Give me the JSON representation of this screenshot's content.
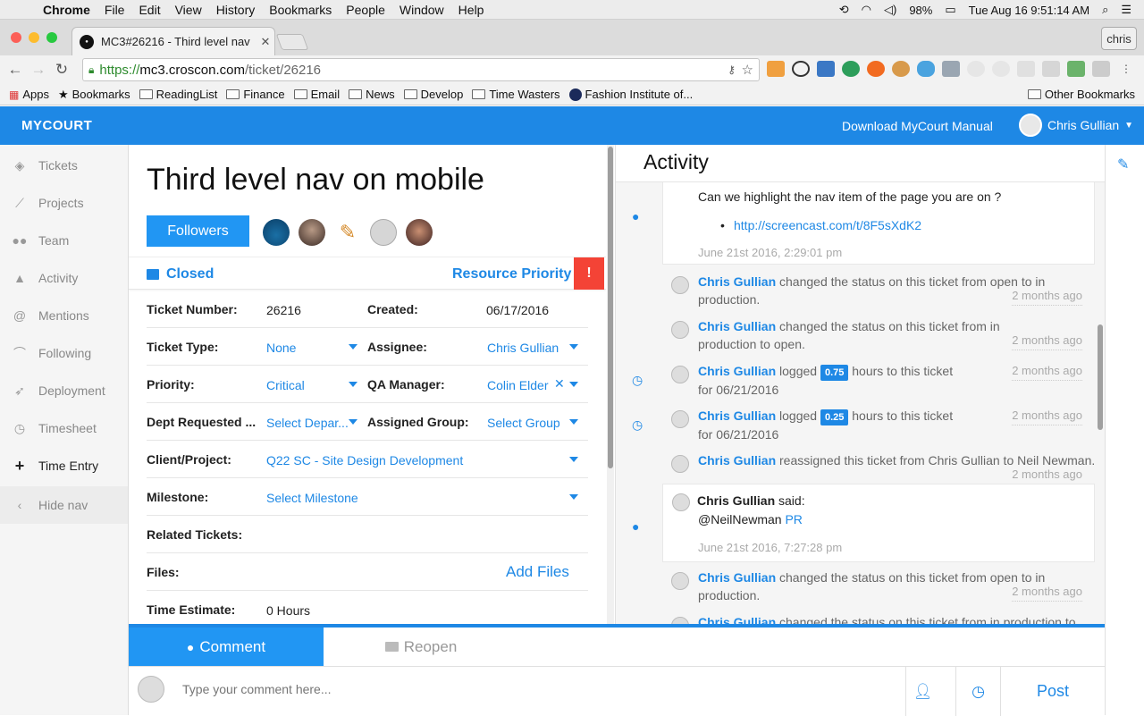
{
  "menubar": {
    "app": "Chrome",
    "items": [
      "File",
      "Edit",
      "View",
      "History",
      "Bookmarks",
      "People",
      "Window",
      "Help"
    ],
    "battery": "98%",
    "clock": "Tue Aug 16  9:51:14 AM"
  },
  "browser": {
    "tab_title": "MC3#26216 - Third level nav",
    "profile": "chris",
    "url_proto": "https://",
    "url_host": "mc3.croscon.com",
    "url_path": "/ticket/26216",
    "bookmarks": [
      "Apps",
      "Bookmarks",
      "ReadingList",
      "Finance",
      "Email",
      "News",
      "Develop",
      "Time Wasters",
      "Fashion Institute of..."
    ],
    "other_bookmarks": "Other Bookmarks"
  },
  "app": {
    "logo": "MYCOURT",
    "manual": "Download MyCourt Manual",
    "user": "Chris Gullian"
  },
  "sidebar": {
    "items": [
      {
        "label": "Tickets",
        "icon": "tag-icon"
      },
      {
        "label": "Projects",
        "icon": "chart-icon"
      },
      {
        "label": "Team",
        "icon": "users-icon"
      },
      {
        "label": "Activity",
        "icon": "bell-icon"
      },
      {
        "label": "Mentions",
        "icon": "at-icon"
      },
      {
        "label": "Following",
        "icon": "rss-icon"
      },
      {
        "label": "Deployment",
        "icon": "rocket-icon"
      },
      {
        "label": "Timesheet",
        "icon": "clock-icon"
      },
      {
        "label": "Time Entry",
        "icon": "plus-icon"
      }
    ],
    "hide_nav": "Hide nav"
  },
  "ticket": {
    "title": "Third level nav on mobile",
    "followers_label": "Followers",
    "status": "Closed",
    "priority_label": "Resource Priority",
    "alert": "!",
    "fields": {
      "ticket_number_label": "Ticket Number:",
      "ticket_number": "26216",
      "created_label": "Created:",
      "created": "06/17/2016",
      "ticket_type_label": "Ticket Type:",
      "ticket_type": "None",
      "assignee_label": "Assignee:",
      "assignee": "Chris Gullian",
      "priority_label": "Priority:",
      "priority": "Critical",
      "qa_label": "QA Manager:",
      "qa": "Colin Elder",
      "dept_label": "Dept Requested ...",
      "dept": "Select Depar...",
      "group_label": "Assigned Group:",
      "group": "Select Group",
      "client_label": "Client/Project:",
      "client": "Q22 SC - Site Design Development",
      "milestone_label": "Milestone:",
      "milestone": "Select Milestone",
      "related_label": "Related Tickets:",
      "files_label": "Files:",
      "add_files": "Add Files",
      "estimate_label": "Time Estimate:",
      "estimate": "0 Hours"
    }
  },
  "activity": {
    "title": "Activity",
    "comment1": {
      "text": "Can we highlight the nav item of the page you are on ?",
      "link": "http://screencast.com/t/8F5sXdK2",
      "date": "June 21st 2016, 2:29:01 pm"
    },
    "log": [
      {
        "who": "Chris Gullian",
        "text": "changed the status on this ticket from open to in production.",
        "ago": "2 months ago"
      },
      {
        "who": "Chris Gullian",
        "text": "changed the status on this ticket from in production to open.",
        "ago": "2 months ago"
      },
      {
        "who": "Chris Gullian",
        "pre": "logged",
        "badge": "0.75",
        "post": "hours to this ticket for 06/21/2016",
        "ago": "2 months ago"
      },
      {
        "who": "Chris Gullian",
        "pre": "logged",
        "badge": "0.25",
        "post": "hours to this ticket for 06/21/2016",
        "ago": "2 months ago"
      },
      {
        "who": "Chris Gullian",
        "text": "reassigned this ticket from Chris Gullian to Neil Newman.",
        "ago": "2 months ago"
      }
    ],
    "comment2": {
      "author": "Chris Gullian",
      "said": "said:",
      "mention": "@NeilNewman",
      "tag": "PR",
      "date": "June 21st 2016, 7:27:28 pm"
    },
    "log2": [
      {
        "who": "Chris Gullian",
        "text": "changed the status on this ticket from open to in production.",
        "ago": "2 months ago"
      },
      {
        "who": "Chris Gullian",
        "text": "changed the status on this ticket from in production to"
      }
    ]
  },
  "composer": {
    "comment_tab": "Comment",
    "reopen_tab": "Reopen",
    "placeholder": "Type your comment here...",
    "post": "Post"
  }
}
